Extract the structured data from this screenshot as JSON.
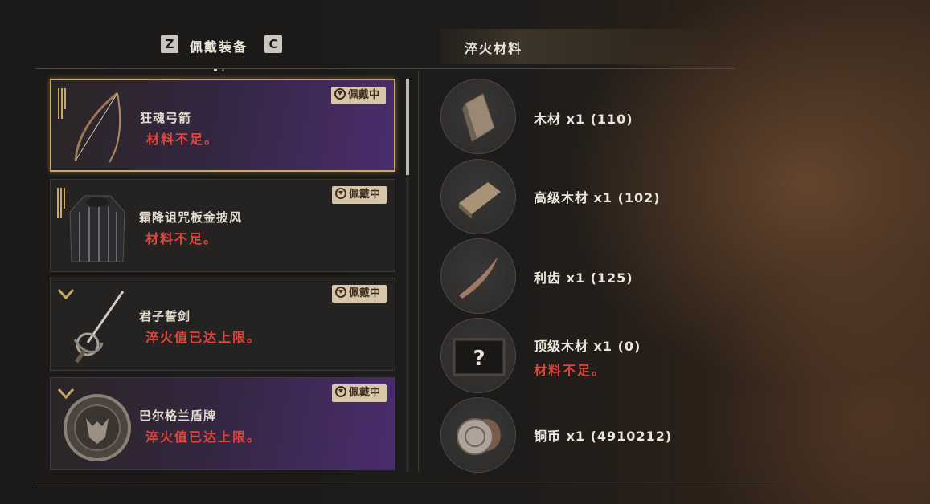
{
  "header": {
    "left_key": "Z",
    "tab_title": "佩戴装备",
    "right_key": "C",
    "right_tab_title": "淬火材料"
  },
  "equipment": [
    {
      "name": "狂魂弓箭",
      "status": "材料不足。",
      "badge": "佩戴中",
      "icon": "bow-icon",
      "tier_icon": "tier-bars-icon"
    },
    {
      "name": "霜降诅咒板金披风",
      "status": "材料不足。",
      "badge": "佩戴中",
      "icon": "cloak-icon",
      "tier_icon": "tier-bars-icon"
    },
    {
      "name": "君子誓剑",
      "status": "淬火值已达上限。",
      "badge": "佩戴中",
      "icon": "rapier-icon",
      "tier_icon": "chevron-down-icon"
    },
    {
      "name": "巴尔格兰盾牌",
      "status": "淬火值已达上限。",
      "badge": "佩戴中",
      "icon": "shield-icon",
      "tier_icon": "chevron-down-icon"
    }
  ],
  "materials": [
    {
      "label": "木材  x1 (110)",
      "icon": "wood-icon"
    },
    {
      "label": "高级木材  x1 (102)",
      "icon": "plank-icon"
    },
    {
      "label": "利齿  x1 (125)",
      "icon": "fang-icon"
    },
    {
      "label": "顶级木材  x1 (0)",
      "status": "材料不足。",
      "icon": "unknown-item-icon"
    },
    {
      "label": "铜币  x1 (4910212)",
      "icon": "coins-icon"
    }
  ],
  "colors": {
    "accent_gold": "#c8a86a",
    "warning_red": "#e0443a",
    "purple_rarity": "#4a2d6e"
  }
}
